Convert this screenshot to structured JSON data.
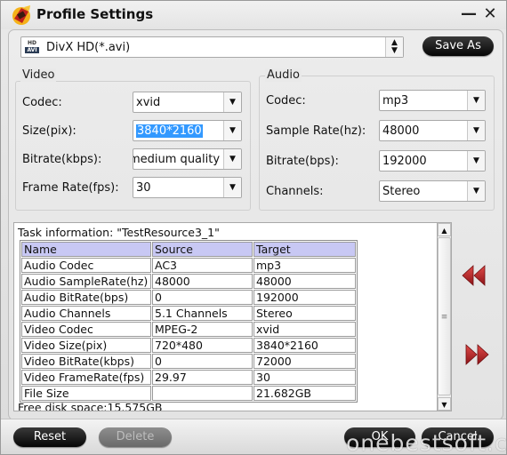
{
  "window": {
    "title": "Profile Settings",
    "minimize_glyph": "—",
    "close_glyph": "✕"
  },
  "profile": {
    "icon": "divx-hd-avi-file-icon",
    "icon_top_text": "HD",
    "icon_bottom_text": "AVI",
    "selected": "DivX HD(*.avi)",
    "spin_glyph": "▲▼",
    "save_as_label": "Save As"
  },
  "video": {
    "group_label": "Video",
    "fields": [
      {
        "label": "Codec:",
        "value": "xvid"
      },
      {
        "label": "Size(pix):",
        "value": "3840*2160"
      },
      {
        "label": "Bitrate(kbps):",
        "value": "medium quality"
      },
      {
        "label": "Frame Rate(fps):",
        "value": "30"
      }
    ]
  },
  "audio": {
    "group_label": "Audio",
    "fields": [
      {
        "label": "Codec:",
        "value": "mp3"
      },
      {
        "label": "Sample Rate(hz):",
        "value": "48000"
      },
      {
        "label": "Bitrate(bps):",
        "value": "192000"
      },
      {
        "label": "Channels:",
        "value": "Stereo"
      }
    ]
  },
  "dropdown_arrow_glyph": "▼",
  "task": {
    "info_text": "Task information: \"TestResource3_1\"",
    "columns": [
      "Name",
      "Source",
      "Target"
    ],
    "rows": [
      [
        "Audio Codec",
        "AC3",
        "mp3"
      ],
      [
        "Audio SampleRate(hz)",
        "48000",
        "48000"
      ],
      [
        "Audio BitRate(bps)",
        "0",
        "192000"
      ],
      [
        "Audio Channels",
        "5.1 Channels",
        "Stereo"
      ],
      [
        "Video Codec",
        "MPEG-2",
        "xvid"
      ],
      [
        "Video Size(pix)",
        "720*480",
        "3840*2160"
      ],
      [
        "Video BitRate(kbps)",
        "0",
        "72000"
      ],
      [
        "Video FrameRate(fps)",
        "29.97",
        "30"
      ],
      [
        "File Size",
        "",
        "21.682GB"
      ]
    ],
    "free_disk_space": "Free disk space:15.575GB",
    "header_color": "#c8c8f4"
  },
  "scrollbar": {
    "up_glyph": "▲",
    "down_glyph": "▼",
    "grip_glyph": "≡"
  },
  "nav": {
    "prev_icon": "rewind-double-left-icon",
    "next_icon": "fast-forward-double-right-icon",
    "arrow_color": "#b01e22"
  },
  "buttons": {
    "reset": "Reset",
    "delete": "Delete",
    "ok": "OK",
    "cancel": "Cancel"
  },
  "watermark": "onebestsoft.com"
}
